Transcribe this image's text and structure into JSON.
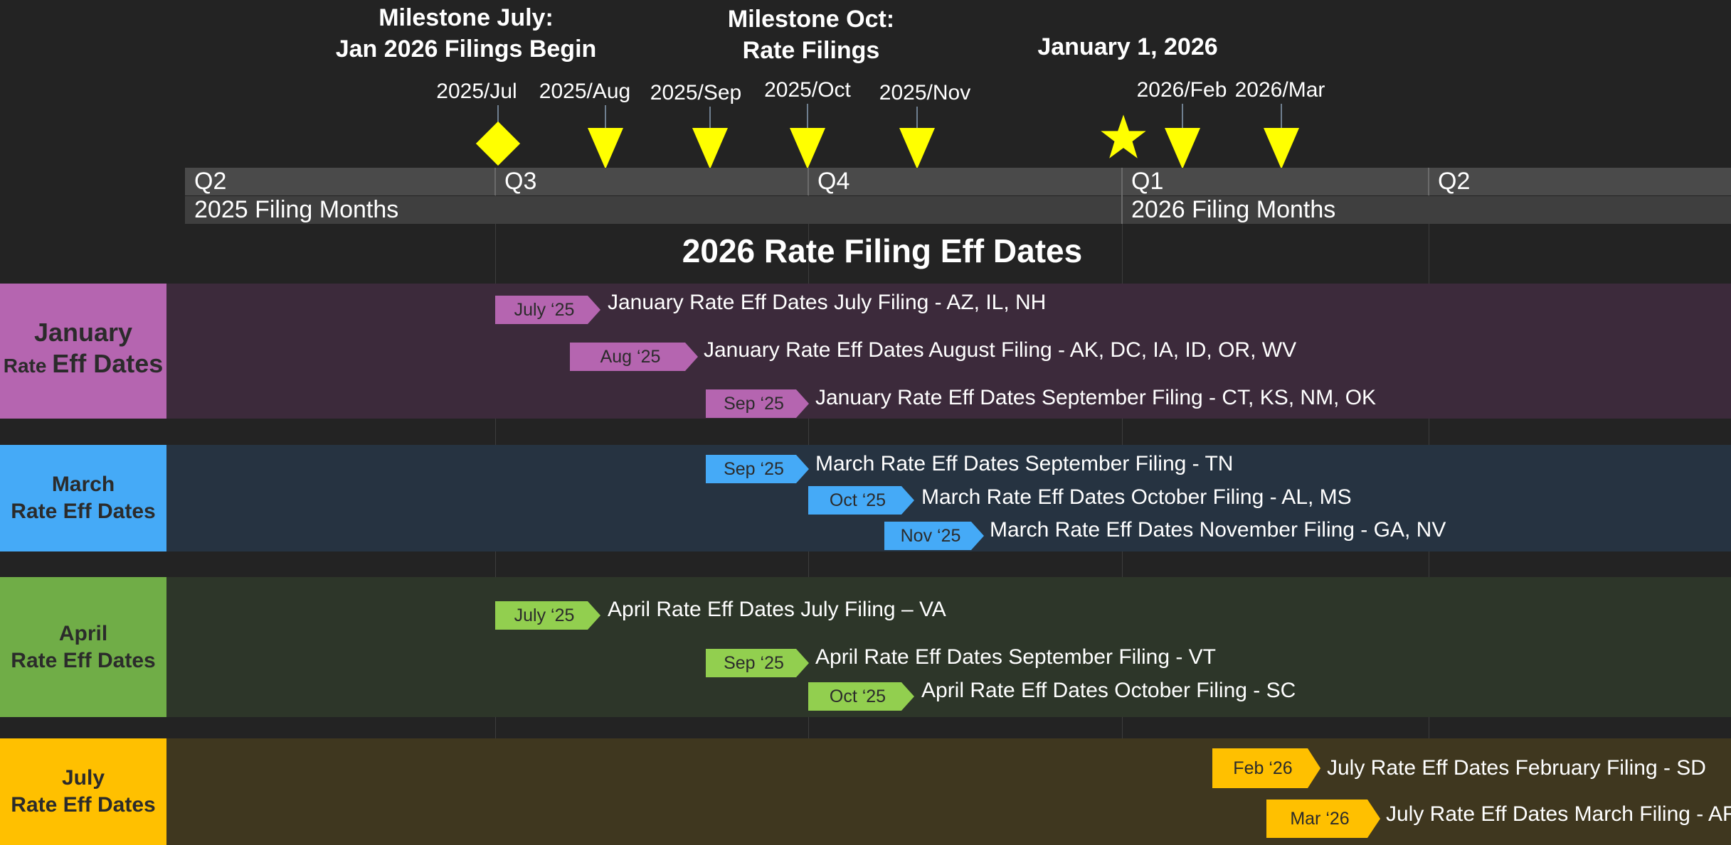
{
  "milestones": {
    "july_line1": "Milestone July:",
    "july_line2": "Jan 2026 Filings Begin",
    "oct_line1": "Milestone Oct:",
    "oct_line2": "Rate Filings",
    "jan_title": "January 1, 2026"
  },
  "months": [
    "2025/Jul",
    "2025/Aug",
    "2025/Sep",
    "2025/Oct",
    "2025/Nov",
    "2026/Feb",
    "2026/Mar"
  ],
  "quarters": [
    "Q2",
    "Q3",
    "Q4",
    "Q1",
    "Q2"
  ],
  "filing_years": [
    "2025 Filing Months",
    "2026 Filing Months"
  ],
  "title": "2026 Rate Filing Eff Dates",
  "colors": {
    "marker": "#ffff00",
    "january": "#b565b0",
    "march": "#45aaf7",
    "april": "#70ad47",
    "april_tag": "#92cf4f",
    "july": "#ffc000"
  },
  "bands": {
    "january": {
      "line1": "January",
      "line2a": "Rate ",
      "line2b": "Eff Dates",
      "rows": [
        {
          "tag": "July ‘25",
          "text": "January Rate Eff Dates July Filing - AZ, IL, NH"
        },
        {
          "tag": "Aug ‘25",
          "text": "January Rate Eff Dates August Filing - AK, DC, IA, ID, OR, WV"
        },
        {
          "tag": "Sep ‘25",
          "text": "January Rate Eff Dates September Filing - CT, KS, NM, OK"
        }
      ]
    },
    "march": {
      "line1": "March",
      "line2": "Rate Eff Dates",
      "rows": [
        {
          "tag": "Sep ‘25",
          "text": "March Rate Eff Dates September Filing - TN"
        },
        {
          "tag": "Oct ‘25",
          "text": "March Rate Eff Dates October Filing - AL, MS"
        },
        {
          "tag": "Nov ‘25",
          "text": "March Rate Eff Dates November Filing - GA, NV"
        }
      ]
    },
    "april": {
      "line1": "April",
      "line2": "Rate Eff Dates",
      "rows": [
        {
          "tag": "July ‘25",
          "text": "April Rate Eff Dates July Filing – VA"
        },
        {
          "tag": "Sep ‘25",
          "text": "April Rate Eff Dates September Filing - VT"
        },
        {
          "tag": "Oct ‘25",
          "text": "April Rate Eff Dates October Filing - SC"
        }
      ]
    },
    "july": {
      "line1": "July",
      "line2": "Rate Eff Dates",
      "rows": [
        {
          "tag": "Feb ‘26",
          "text": "July Rate Eff Dates February Filing - SD"
        },
        {
          "tag": "Mar ‘26",
          "text": "July Rate Eff Dates March Filing - AR"
        }
      ]
    }
  }
}
